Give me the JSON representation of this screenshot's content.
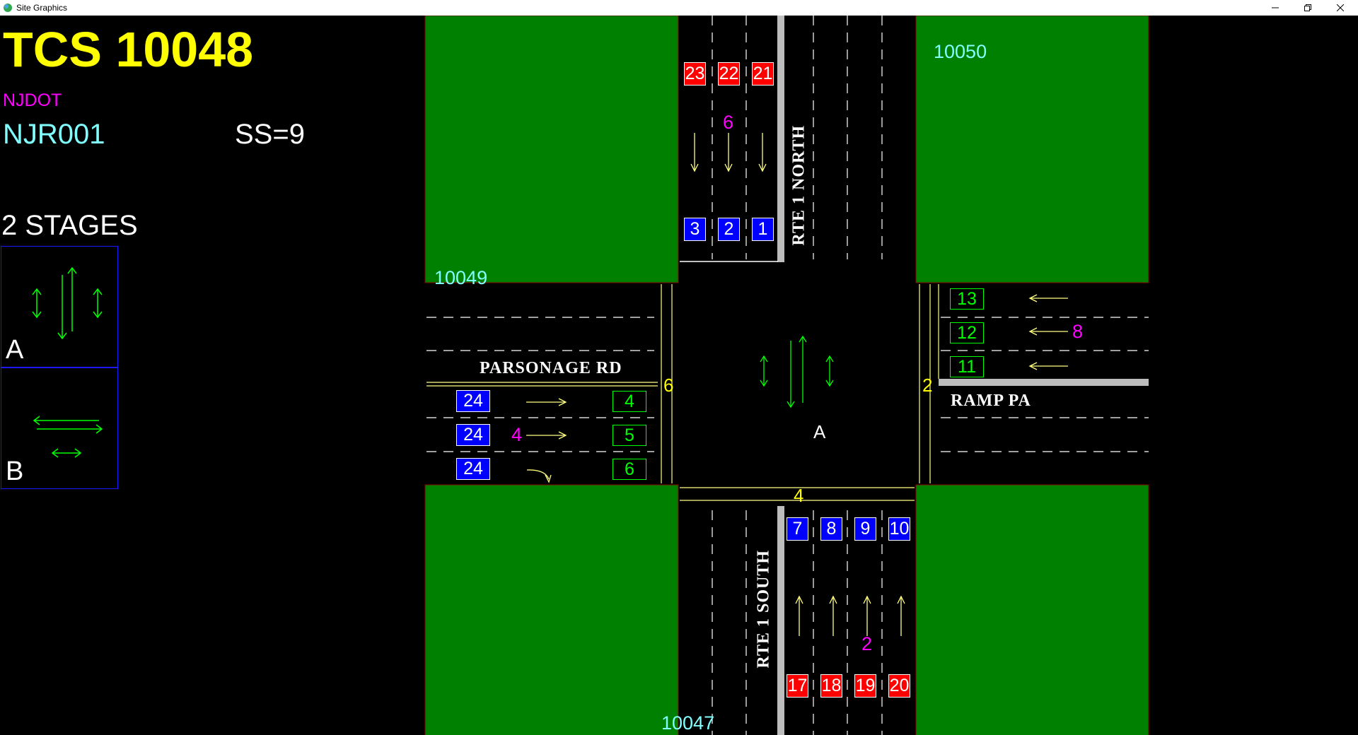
{
  "window": {
    "title": "Site Graphics"
  },
  "header": {
    "tcs": "TCS 10048",
    "owner": "NJDOT",
    "site": "NJR001",
    "ss": "SS=9",
    "stages_title": "2 STAGES"
  },
  "stages": [
    {
      "label": "A"
    },
    {
      "label": "B"
    }
  ],
  "roads": {
    "north": "RTE 1 NORTH",
    "south": "RTE 1 SOUTH",
    "west": "PARSONAGE RD",
    "east": "RAMP PA"
  },
  "nodes": {
    "nw": "10049",
    "ne": "10050",
    "s": "10047"
  },
  "detectors": {
    "north_red": [
      "23",
      "22",
      "21"
    ],
    "north_blue": [
      "3",
      "2",
      "1"
    ],
    "south_blue": [
      "7",
      "8",
      "9",
      "10"
    ],
    "south_red": [
      "17",
      "18",
      "19",
      "20"
    ],
    "west_blue": [
      "24",
      "24",
      "24"
    ],
    "west_green": [
      "4",
      "5",
      "6"
    ],
    "east_green": [
      "13",
      "12",
      "11"
    ]
  },
  "phases": {
    "north": "6",
    "west": "4",
    "east": "8",
    "south": "2"
  },
  "crossings": {
    "west": "6",
    "east": "2",
    "south": "4"
  },
  "centre_stage": "A",
  "colors": {
    "grass": "#008000",
    "road": "#000000",
    "title": "#ffff00",
    "phase": "#ff00ff",
    "node": "#80ffff",
    "lane_arrow": "#ffff80",
    "stage_arrow": "#00ff00"
  }
}
